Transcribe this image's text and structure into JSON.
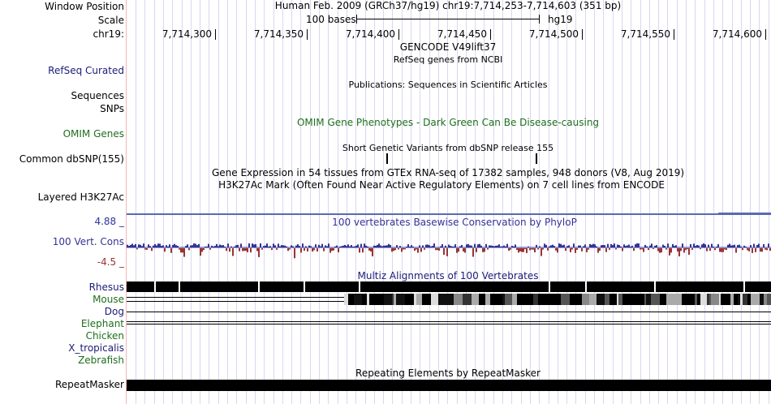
{
  "header": {
    "window_position_label": "Window Position",
    "scale_label": "Scale",
    "chrom_label": "chr19:",
    "assembly_text": "Human Feb. 2009 (GRCh37/hg19)   chr19:7,714,253-7,714,603 (351 bp)",
    "scale_text": "100 bases",
    "scale_db": "hg19",
    "positions": [
      "7,714,300",
      "7,714,350",
      "7,714,400",
      "7,714,450",
      "7,714,500",
      "7,714,550",
      "7,714,600"
    ]
  },
  "tracks": {
    "gencode": "GENCODE V49lift37",
    "refseq_title": "RefSeq genes from NCBI",
    "refseq_label": "RefSeq Curated",
    "publications": "Publications: Sequences in Scientific Articles",
    "sequences_label": "Sequences",
    "snps_label": "SNPs",
    "omim_label": "OMIM Genes",
    "omim_title": "OMIM Gene Phenotypes - Dark Green Can Be Disease-causing",
    "dbsnp_title": "Short Genetic Variants from dbSNP release 155",
    "dbsnp_label": "Common dbSNP(155)",
    "gtex_title": "Gene Expression in 54 tissues from GTEx RNA-seq of 17382 samples, 948 donors (V8, Aug 2019)",
    "h3k27ac_title": "H3K27Ac Mark (Often Found Near Active Regulatory Elements) on 7 cell lines from ENCODE",
    "h3k27ac_label": "Layered H3K27Ac",
    "cons_max": "4.88 _",
    "cons_min": "-4.5 _",
    "cons_title": "100 vertebrates Basewise Conservation by PhyloP",
    "cons_label": "100 Vert. Cons",
    "multiz_title": "Multiz Alignments of 100 Vertebrates",
    "species": [
      "Rhesus",
      "Mouse",
      "Dog",
      "Elephant",
      "Chicken",
      "X_tropicalis",
      "Zebrafish"
    ],
    "repeat_title": "Repeating Elements by RepeatMasker",
    "repeat_label": "RepeatMasker"
  },
  "colors": {
    "refseq_label": "#1b1b78",
    "omim_green": "#1e6e1e",
    "cons_blue": "#333399",
    "cons_red": "#993333",
    "species_blue": "#1b1b78",
    "species_green": "#1e6e1e"
  }
}
